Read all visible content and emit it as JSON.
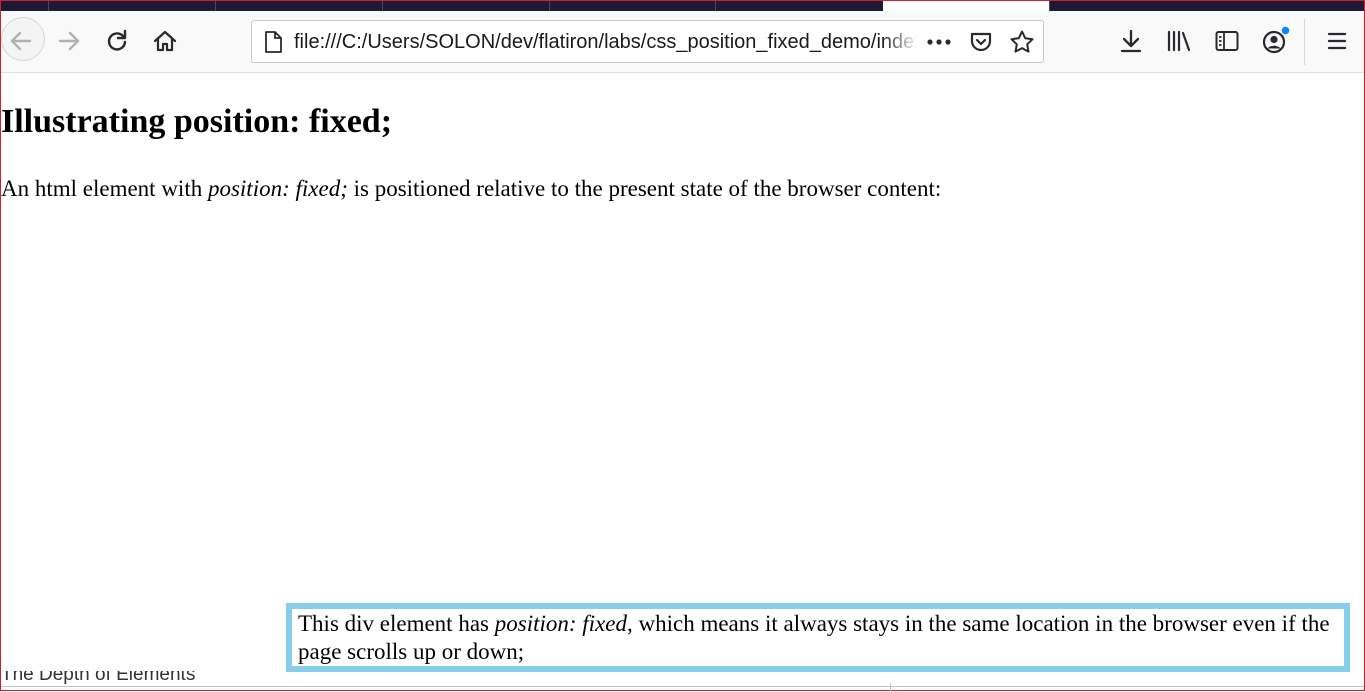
{
  "browser": {
    "url": "file:///C:/Users/SOLON/dev/flatiron/labs/css_position_fixed_demo/index.html",
    "icons": {
      "back": "arrow-left-icon",
      "forward": "arrow-right-icon",
      "reload": "reload-icon",
      "home": "home-icon",
      "page": "page-icon",
      "page_actions": "ellipsis-icon",
      "pocket": "pocket-icon",
      "bookmark": "star-icon",
      "downloads": "download-icon",
      "library": "library-icon",
      "sidebar": "sidebar-icon",
      "account": "account-icon",
      "menu": "hamburger-menu-icon"
    },
    "colors": {
      "tabstrip": "#1f1a33",
      "account_badge": "#0a84ff",
      "window_border": "#d02030"
    }
  },
  "page": {
    "heading": "Illustrating position: fixed;",
    "intro": {
      "before": "An html element with ",
      "emphasis": "position: fixed;",
      "after": " is positioned relative to the present state of the browser content:"
    },
    "fixed_div": {
      "before": "This div element has ",
      "emphasis": "position: fixed",
      "after": ", which means it always stays in the same location in the browser even if the page scrolls up or down;",
      "border_color": "#87ceeb"
    },
    "scrolled_text": "The Depth of Elements"
  }
}
